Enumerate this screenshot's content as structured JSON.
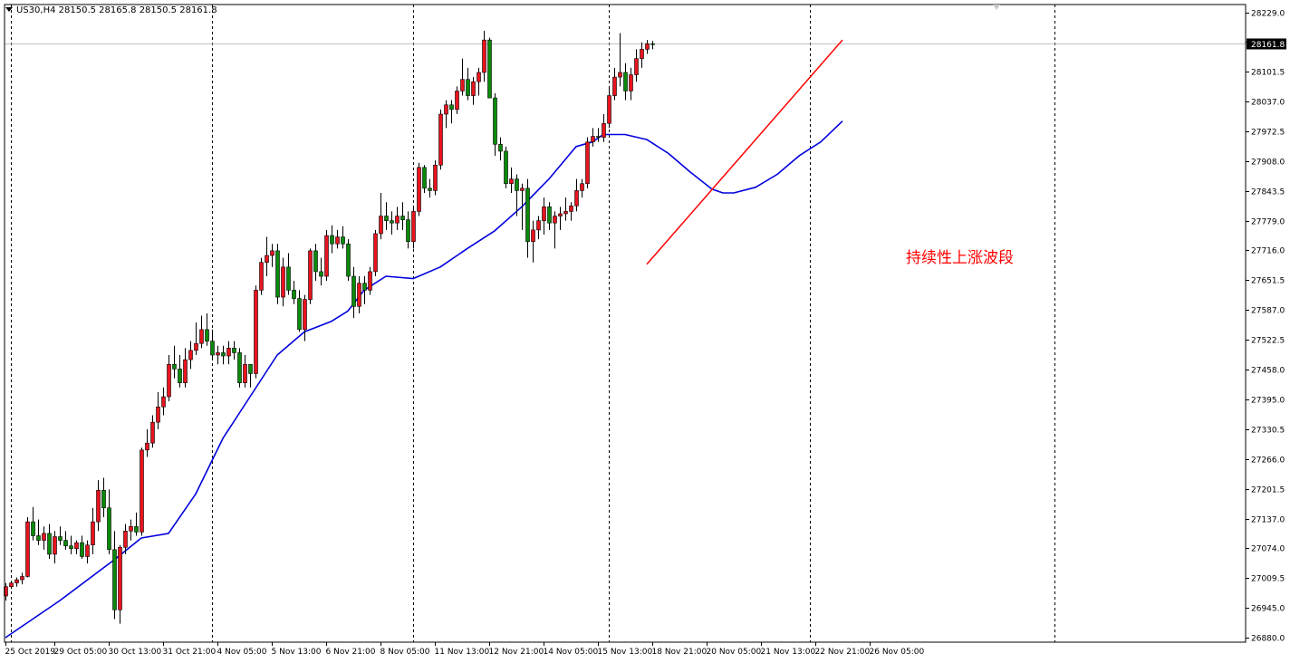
{
  "header": {
    "symbol_info": "US30,H4  28150.5 28165.8 28150.5 28161.8"
  },
  "annotation": "持续性上涨波段",
  "colors": {
    "bull": "#e8141e",
    "bear": "#0a8a0a",
    "ma": "#0000dd",
    "trendline": "#ff0000",
    "current_bg": "#000000",
    "grid": "#000000"
  },
  "icons": {
    "menu": "triangle-down-icon",
    "scroll_marker": "triangle-down-icon"
  },
  "chart_data": {
    "type": "candlestick",
    "ylim": [
      26880,
      28229
    ],
    "y_ticks": [
      "28229.0",
      "28165.5",
      "28101.5",
      "28037.0",
      "27972.5",
      "27908.0",
      "27843.5",
      "27779.0",
      "27716.0",
      "27651.5",
      "27587.0",
      "27522.5",
      "27458.0",
      "27395.0",
      "27330.5",
      "27266.0",
      "27201.5",
      "27137.0",
      "27074.0",
      "27009.5",
      "26945.0",
      "26880.0"
    ],
    "x_ticks": [
      {
        "i": 0,
        "label": "25 Oct 2019"
      },
      {
        "i": 9,
        "label": "29 Oct 05:00"
      },
      {
        "i": 19,
        "label": "30 Oct 13:00"
      },
      {
        "i": 29,
        "label": "31 Oct 21:00"
      },
      {
        "i": 39,
        "label": "4 Nov 05:00"
      },
      {
        "i": 49,
        "label": "5 Nov 13:00"
      },
      {
        "i": 59,
        "label": "6 Nov 21:00"
      },
      {
        "i": 69,
        "label": "8 Nov 05:00"
      },
      {
        "i": 79,
        "label": "11 Nov 13:00"
      },
      {
        "i": 89,
        "label": "12 Nov 21:00"
      },
      {
        "i": 99,
        "label": "14 Nov 05:00"
      },
      {
        "i": 109,
        "label": "15 Nov 13:00"
      },
      {
        "i": 119,
        "label": "18 Nov 21:00"
      },
      {
        "i": 129,
        "label": "20 Nov 05:00"
      },
      {
        "i": 139,
        "label": "21 Nov 13:00"
      },
      {
        "i": 149,
        "label": "22 Nov 21:00"
      },
      {
        "i": 159,
        "label": "26 Nov 05:00"
      }
    ],
    "day_separators": [
      1,
      38,
      75,
      111,
      148,
      193
    ],
    "current_price": "28161.8",
    "candles": [
      [
        26970,
        26998,
        26960,
        26990
      ],
      [
        26990,
        27003,
        26985,
        26998
      ],
      [
        26998,
        27010,
        26990,
        27005
      ],
      [
        27005,
        27020,
        26995,
        27012
      ],
      [
        27012,
        27140,
        27010,
        27130
      ],
      [
        27130,
        27162,
        27090,
        27100
      ],
      [
        27100,
        27135,
        27080,
        27090
      ],
      [
        27090,
        27120,
        27070,
        27105
      ],
      [
        27105,
        27125,
        27050,
        27060
      ],
      [
        27060,
        27110,
        27040,
        27098
      ],
      [
        27098,
        27120,
        27080,
        27090
      ],
      [
        27090,
        27110,
        27070,
        27078
      ],
      [
        27078,
        27100,
        27060,
        27072
      ],
      [
        27072,
        27090,
        27060,
        27085
      ],
      [
        27085,
        27100,
        27050,
        27055
      ],
      [
        27055,
        27090,
        27040,
        27080
      ],
      [
        27080,
        27160,
        27060,
        27130
      ],
      [
        27130,
        27220,
        27110,
        27198
      ],
      [
        27198,
        27225,
        27140,
        27160
      ],
      [
        27160,
        27200,
        27060,
        27070
      ],
      [
        27070,
        27110,
        26920,
        26940
      ],
      [
        26940,
        27080,
        26910,
        27075
      ],
      [
        27075,
        27125,
        27060,
        27110
      ],
      [
        27110,
        27135,
        27090,
        27120
      ],
      [
        27120,
        27150,
        27100,
        27108
      ],
      [
        27108,
        27290,
        27100,
        27285
      ],
      [
        27285,
        27330,
        27270,
        27300
      ],
      [
        27300,
        27360,
        27290,
        27345
      ],
      [
        27345,
        27410,
        27330,
        27378
      ],
      [
        27378,
        27420,
        27360,
        27400
      ],
      [
        27400,
        27490,
        27390,
        27470
      ],
      [
        27470,
        27510,
        27440,
        27460
      ],
      [
        27460,
        27490,
        27420,
        27430
      ],
      [
        27430,
        27505,
        27420,
        27480
      ],
      [
        27480,
        27520,
        27460,
        27500
      ],
      [
        27500,
        27560,
        27490,
        27515
      ],
      [
        27515,
        27575,
        27505,
        27545
      ],
      [
        27545,
        27580,
        27510,
        27520
      ],
      [
        27520,
        27545,
        27480,
        27490
      ],
      [
        27490,
        27510,
        27470,
        27495
      ],
      [
        27495,
        27510,
        27470,
        27488
      ],
      [
        27488,
        27520,
        27470,
        27505
      ],
      [
        27505,
        27520,
        27480,
        27495
      ],
      [
        27495,
        27505,
        27420,
        27430
      ],
      [
        27430,
        27490,
        27420,
        27470
      ],
      [
        27470,
        27470,
        27420,
        27450
      ],
      [
        27450,
        27640,
        27440,
        27630
      ],
      [
        27630,
        27700,
        27620,
        27690
      ],
      [
        27690,
        27745,
        27660,
        27705
      ],
      [
        27705,
        27730,
        27680,
        27715
      ],
      [
        27715,
        27730,
        27600,
        27615
      ],
      [
        27615,
        27700,
        27595,
        27680
      ],
      [
        27680,
        27710,
        27620,
        27630
      ],
      [
        27630,
        27650,
        27600,
        27612
      ],
      [
        27612,
        27630,
        27540,
        27545
      ],
      [
        27545,
        27620,
        27520,
        27610
      ],
      [
        27610,
        27720,
        27600,
        27715
      ],
      [
        27715,
        27730,
        27650,
        27670
      ],
      [
        27670,
        27700,
        27640,
        27660
      ],
      [
        27660,
        27760,
        27650,
        27748
      ],
      [
        27748,
        27770,
        27710,
        27730
      ],
      [
        27730,
        27760,
        27720,
        27745
      ],
      [
        27745,
        27768,
        27720,
        27730
      ],
      [
        27730,
        27740,
        27650,
        27660
      ],
      [
        27660,
        27680,
        27570,
        27595
      ],
      [
        27595,
        27660,
        27580,
        27645
      ],
      [
        27645,
        27660,
        27600,
        27630
      ],
      [
        27630,
        27680,
        27620,
        27670
      ],
      [
        27670,
        27760,
        27660,
        27752
      ],
      [
        27752,
        27840,
        27740,
        27790
      ],
      [
        27790,
        27820,
        27760,
        27780
      ],
      [
        27780,
        27800,
        27750,
        27775
      ],
      [
        27775,
        27810,
        27760,
        27790
      ],
      [
        27790,
        27820,
        27760,
        27782
      ],
      [
        27782,
        27800,
        27720,
        27735
      ],
      [
        27735,
        27810,
        27720,
        27800
      ],
      [
        27800,
        27905,
        27790,
        27895
      ],
      [
        27895,
        27900,
        27840,
        27850
      ],
      [
        27850,
        27870,
        27830,
        27845
      ],
      [
        27845,
        27910,
        27835,
        27900
      ],
      [
        27900,
        28020,
        27890,
        28010
      ],
      [
        28010,
        28040,
        27980,
        28030
      ],
      [
        28030,
        28040,
        27990,
        28020
      ],
      [
        28020,
        28070,
        28010,
        28060
      ],
      [
        28060,
        28130,
        28050,
        28085
      ],
      [
        28085,
        28110,
        28040,
        28050
      ],
      [
        28050,
        28090,
        28030,
        28080
      ],
      [
        28080,
        28110,
        28050,
        28100
      ],
      [
        28100,
        28190,
        28080,
        28170
      ],
      [
        28170,
        28175,
        28060,
        28045
      ],
      [
        28045,
        28055,
        27920,
        27945
      ],
      [
        27945,
        27960,
        27910,
        27930
      ],
      [
        27930,
        27940,
        27850,
        27860
      ],
      [
        27860,
        27895,
        27840,
        27870
      ],
      [
        27870,
        27880,
        27790,
        27845
      ],
      [
        27845,
        27860,
        27760,
        27850
      ],
      [
        27850,
        27870,
        27700,
        27735
      ],
      [
        27735,
        27780,
        27690,
        27760
      ],
      [
        27760,
        27790,
        27740,
        27780
      ],
      [
        27780,
        27830,
        27750,
        27810
      ],
      [
        27810,
        27820,
        27760,
        27775
      ],
      [
        27775,
        27800,
        27720,
        27790
      ],
      [
        27790,
        27810,
        27760,
        27795
      ],
      [
        27795,
        27830,
        27780,
        27800
      ],
      [
        27800,
        27820,
        27780,
        27812
      ],
      [
        27812,
        27870,
        27800,
        27845
      ],
      [
        27845,
        27870,
        27830,
        27860
      ],
      [
        27860,
        27960,
        27850,
        27950
      ],
      [
        27950,
        27980,
        27940,
        27962
      ],
      [
        27962,
        27980,
        27950,
        27960
      ],
      [
        27960,
        28010,
        27950,
        27990
      ],
      [
        27990,
        28070,
        27980,
        28050
      ],
      [
        28050,
        28110,
        28040,
        28090
      ],
      [
        28090,
        28185,
        28070,
        28100
      ],
      [
        28100,
        28120,
        28040,
        28060
      ],
      [
        28060,
        28110,
        28040,
        28095
      ],
      [
        28095,
        28150,
        28080,
        28130
      ],
      [
        28130,
        28165,
        28110,
        28150
      ],
      [
        28150,
        28170,
        28140,
        28162
      ],
      [
        28162,
        28168,
        28150,
        28161.8
      ]
    ],
    "ma_line": [
      [
        0,
        26880
      ],
      [
        10,
        26960
      ],
      [
        20,
        27048
      ],
      [
        25,
        27095
      ],
      [
        30,
        27105
      ],
      [
        35,
        27190
      ],
      [
        40,
        27310
      ],
      [
        45,
        27400
      ],
      [
        50,
        27490
      ],
      [
        55,
        27540
      ],
      [
        60,
        27563
      ],
      [
        63,
        27585
      ],
      [
        66,
        27630
      ],
      [
        70,
        27660
      ],
      [
        75,
        27655
      ],
      [
        80,
        27680
      ],
      [
        85,
        27720
      ],
      [
        90,
        27758
      ],
      [
        95,
        27810
      ],
      [
        100,
        27870
      ],
      [
        105,
        27940
      ],
      [
        108,
        27950
      ],
      [
        110,
        27966
      ],
      [
        114,
        27966
      ],
      [
        118,
        27955
      ],
      [
        122,
        27925
      ],
      [
        126,
        27885
      ],
      [
        130,
        27848
      ],
      [
        132,
        27840
      ],
      [
        134,
        27840
      ],
      [
        138,
        27852
      ],
      [
        142,
        27880
      ],
      [
        146,
        27920
      ],
      [
        150,
        27950
      ],
      [
        154,
        27995
      ]
    ],
    "trendline": [
      [
        118,
        27686
      ],
      [
        154,
        28170
      ]
    ]
  }
}
